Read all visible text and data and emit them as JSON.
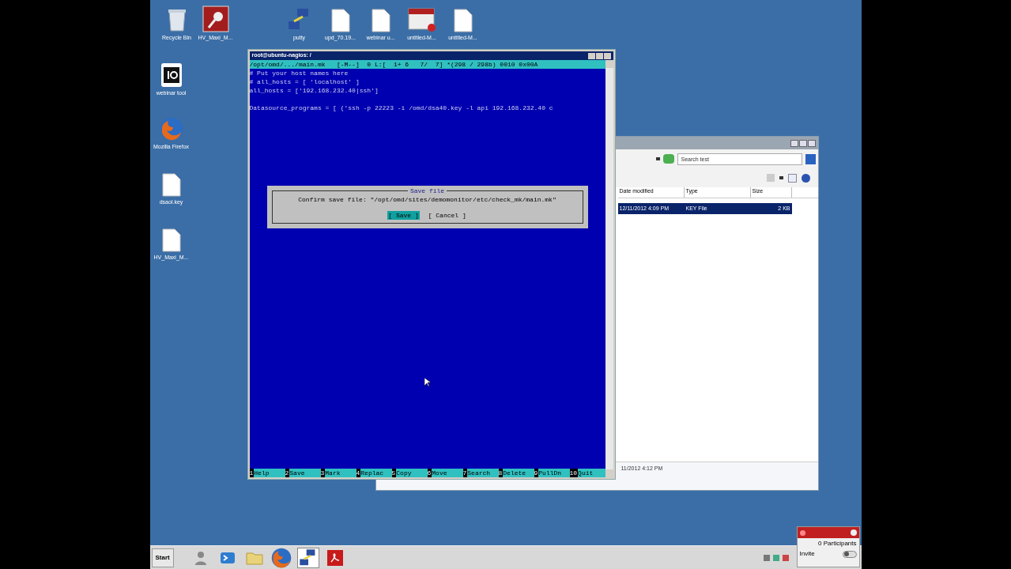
{
  "desktop_icons": [
    {
      "label": "Recycle Bin",
      "kind": "bin"
    },
    {
      "label": "HV_Maxi_M...",
      "kind": "app"
    },
    {
      "label": "putty",
      "kind": "net"
    },
    {
      "label": "upd_70.19...",
      "kind": "doc"
    },
    {
      "label": "webinar u...",
      "kind": "doc"
    },
    {
      "label": "untitled-M...",
      "kind": "video"
    },
    {
      "label": "untitled-M...",
      "kind": "doc"
    },
    {
      "label": "webinar tool",
      "kind": "io"
    },
    {
      "label": "Mozilla Firefox",
      "kind": "firefox"
    },
    {
      "label": "dsaol.key",
      "kind": "doc"
    },
    {
      "label": "HV_Maxi_M...",
      "kind": "doc"
    }
  ],
  "explorer": {
    "search_placeholder": "Search test",
    "columns": [
      "Date modified",
      "Type",
      "Size"
    ],
    "rows": [
      {
        "cells": [
          "12/11/2012 4:09 PM",
          "KEY File",
          "2 KB"
        ],
        "selected": true
      }
    ],
    "details": "11/2012 4:12 PM"
  },
  "terminal": {
    "title": "root@ubuntu-nagios: /",
    "status_line": "/opt/omd/.../main.mk   [-M--]  0 L:[  1+ 6   7/  7] *(298 / 298b) 0010 0x00A",
    "line_blocks": [
      [
        "# Put your host names here",
        "# all_hosts = [ 'localhost' ]",
        "all_hosts = ['192.168.232.40|ssh']"
      ],
      [
        "Datasource_programs = [ ('ssh -p 22223 -i /omd/dsa40.key -l api 192.168.232.40 c"
      ]
    ],
    "dialog": {
      "title": "Save file",
      "message": "Confirm save file: \"/opt/omd/sites/demomonitor/etc/check_mk/main.mk\"",
      "buttons": [
        {
          "label": "[ Save ]",
          "selected": true
        },
        {
          "label": "[ Cancel ]",
          "selected": false
        }
      ]
    },
    "function_keys": [
      {
        "key": "1",
        "label": "Help"
      },
      {
        "key": "2",
        "label": "Save"
      },
      {
        "key": "3",
        "label": "Mark"
      },
      {
        "key": "4",
        "label": "Replac"
      },
      {
        "key": "5",
        "label": "Copy"
      },
      {
        "key": "6",
        "label": "Move"
      },
      {
        "key": "7",
        "label": "Search"
      },
      {
        "key": "8",
        "label": "Delete"
      },
      {
        "key": "9",
        "label": "PullDn"
      },
      {
        "key": "10",
        "label": "Quit"
      }
    ]
  },
  "taskbar": {
    "start": "Start",
    "apps": [
      {
        "kind": "user",
        "active": false
      },
      {
        "kind": "shell",
        "active": false
      },
      {
        "kind": "folder",
        "active": false
      },
      {
        "kind": "firefox",
        "active": false
      },
      {
        "kind": "net",
        "active": true
      },
      {
        "kind": "pdf",
        "active": false
      }
    ]
  },
  "meeting_panel": {
    "participants": "0 Participants",
    "invite": "Invite",
    "invite_on": false
  }
}
